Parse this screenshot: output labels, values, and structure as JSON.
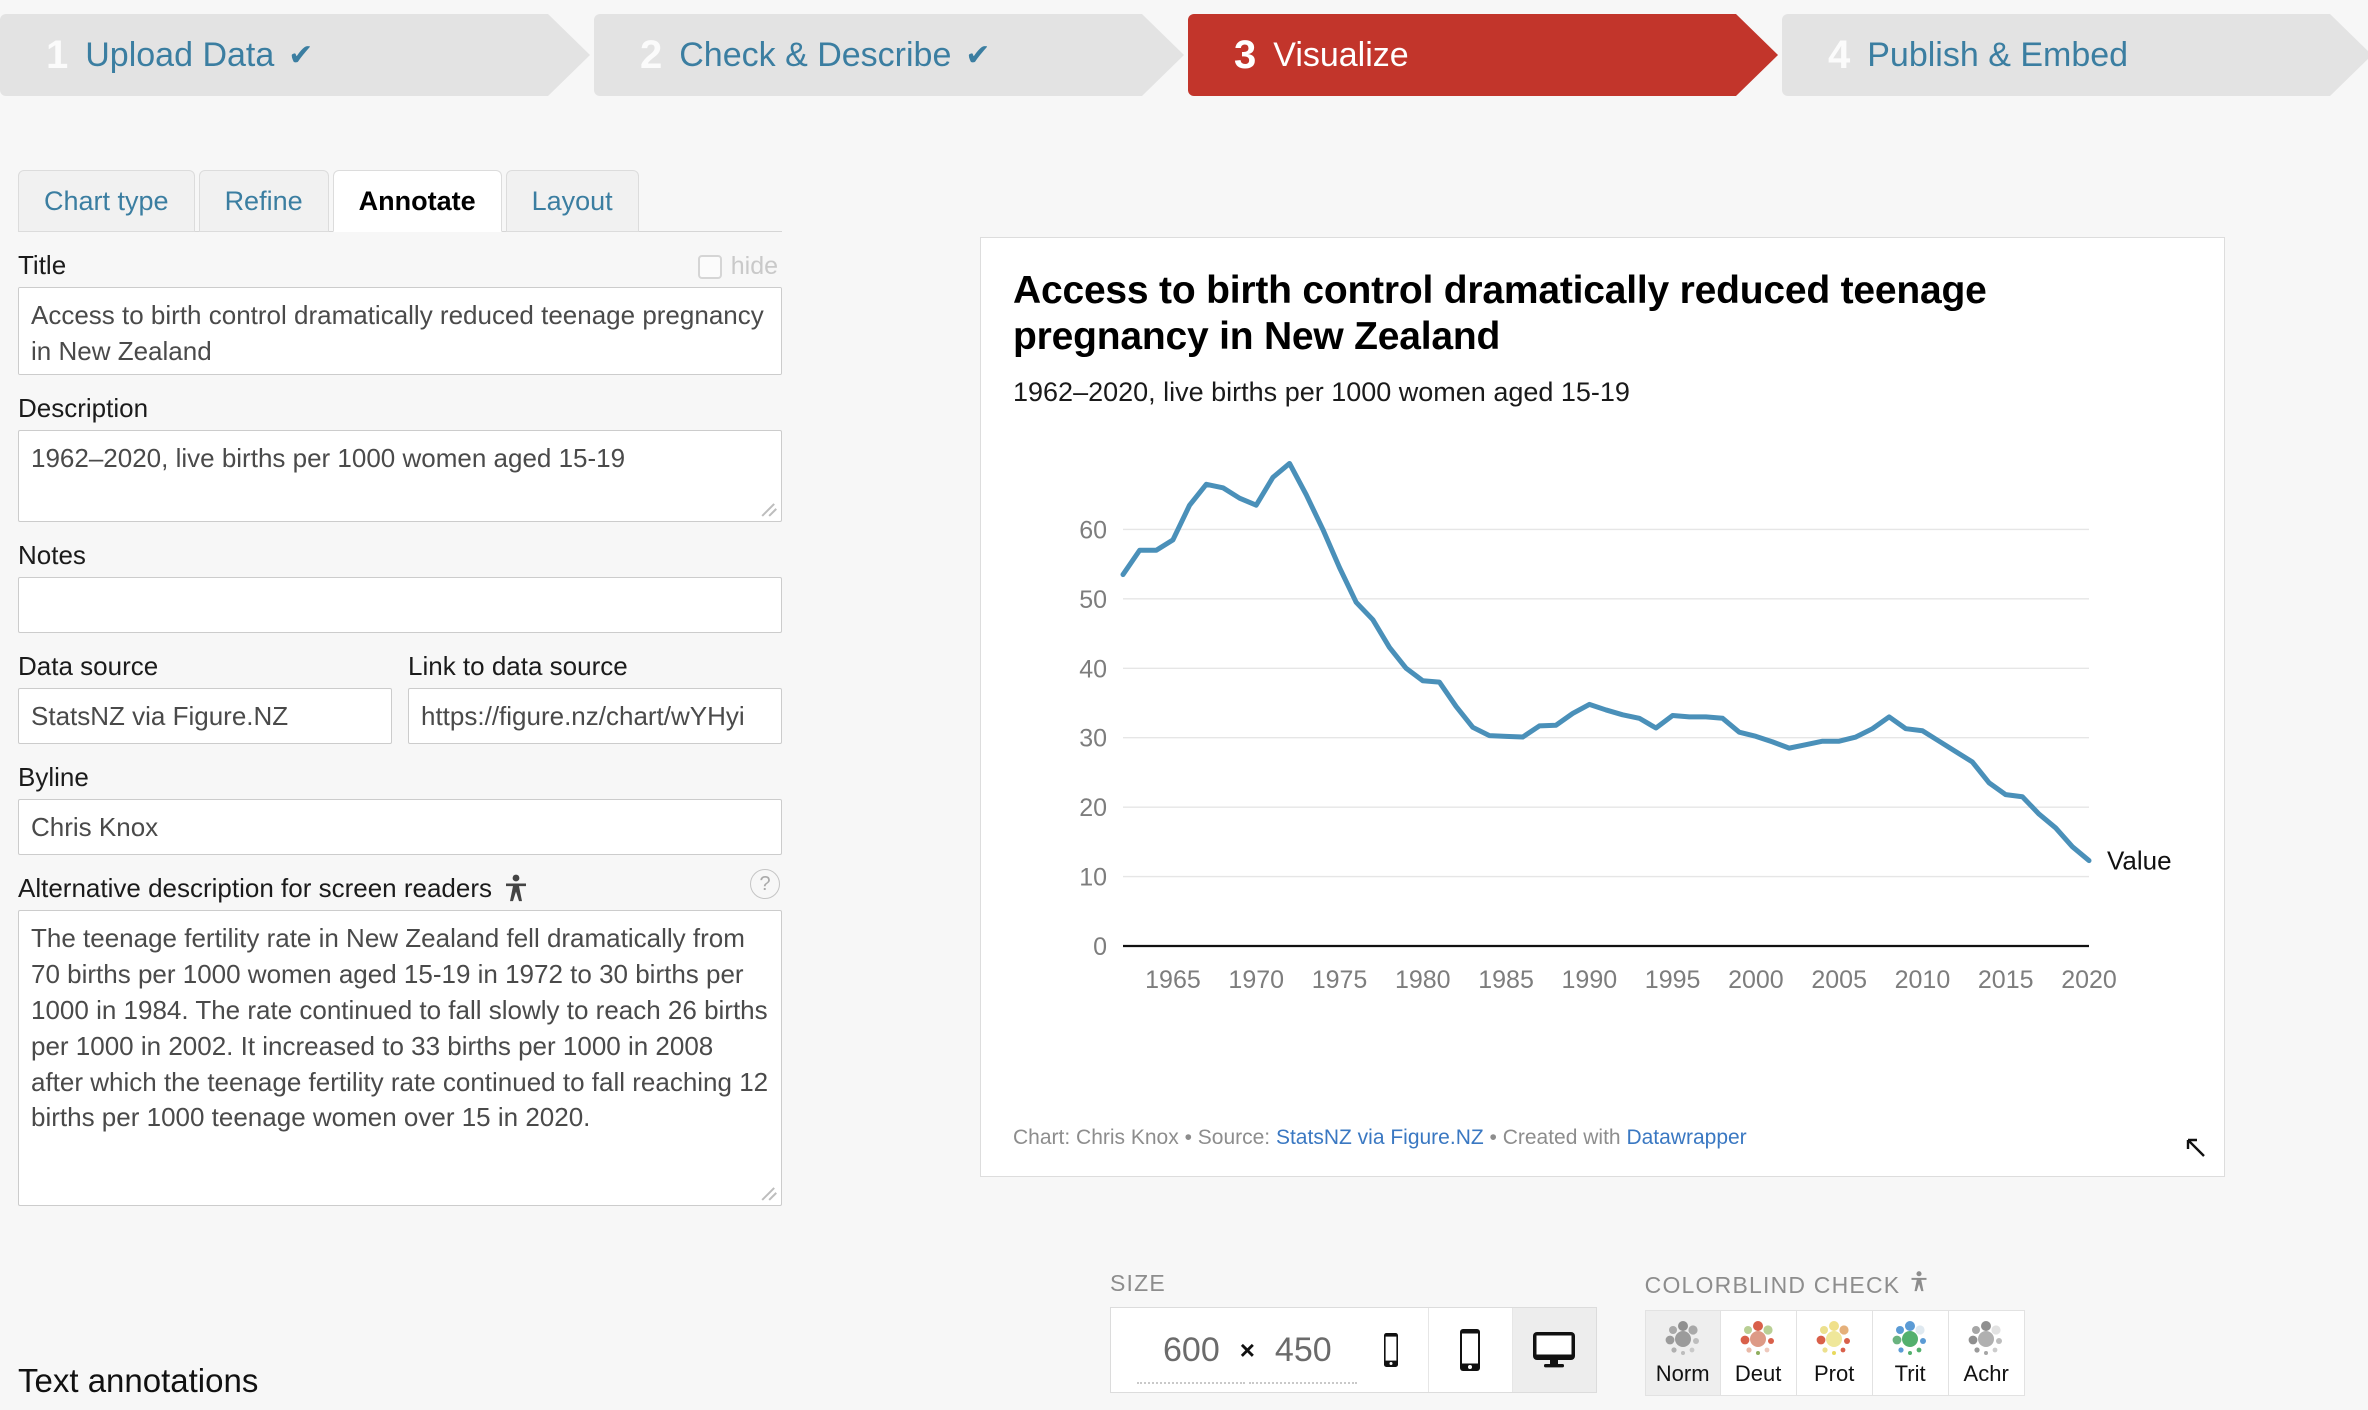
{
  "steps": [
    {
      "num": "1",
      "label": "Upload Data",
      "check": "✔",
      "state": "done"
    },
    {
      "num": "2",
      "label": "Check & Describe",
      "check": "✔",
      "state": "done"
    },
    {
      "num": "3",
      "label": "Visualize",
      "check": "",
      "state": "active"
    },
    {
      "num": "4",
      "label": "Publish & Embed",
      "check": "",
      "state": "todo"
    }
  ],
  "accent_active": "#c2352b",
  "accent_link": "#3b7ea1",
  "series_color": "#4a90b9",
  "tabs": [
    {
      "label": "Chart type",
      "active": false
    },
    {
      "label": "Refine",
      "active": false
    },
    {
      "label": "Annotate",
      "active": true
    },
    {
      "label": "Layout",
      "active": false
    }
  ],
  "form": {
    "title_label": "Title",
    "hide_label": "hide",
    "title_value": "Access to birth control dramatically reduced teenage pregnancy in New Zealand",
    "description_label": "Description",
    "description_value": "1962–2020, live births per 1000 women aged 15-19",
    "notes_label": "Notes",
    "notes_value": "",
    "data_source_label": "Data source",
    "data_source_value": "StatsNZ via Figure.NZ",
    "link_label": "Link to data source",
    "link_value": "https://figure.nz/chart/wYHyi",
    "byline_label": "Byline",
    "byline_value": "Chris Knox",
    "alt_label": "Alternative description for screen readers",
    "help_glyph": "?",
    "alt_value": "The teenage fertility rate in New Zealand fell dramatically from 70 births per 1000 women aged 15-19 in 1972 to 30 births per 1000 in 1984. The rate continued to fall slowly to reach 26 births per 1000 in 2002. It increased to 33 births per 1000 in 2008 after which the teenage fertility rate continued to fall reaching 12 births per 1000 teenage women over 15 in 2020.",
    "text_annotations_heading": "Text annotations"
  },
  "chart_card": {
    "footer_prefix": "Chart: ",
    "footer_author": "Chris Knox",
    "footer_sep1": " • Source: ",
    "footer_source": "StatsNZ via Figure.NZ",
    "footer_sep2": " • Created with ",
    "footer_tool": "Datawrapper"
  },
  "bottom": {
    "size_label": "SIZE",
    "width": "600",
    "x_glyph": "×",
    "height": "450",
    "colorblind_label": "COLORBLIND CHECK",
    "cb_buttons": [
      {
        "label": "Norm",
        "active": true
      },
      {
        "label": "Deut",
        "active": false
      },
      {
        "label": "Prot",
        "active": false
      },
      {
        "label": "Trit",
        "active": false
      },
      {
        "label": "Achr",
        "active": false
      }
    ]
  },
  "chart_data": {
    "type": "line",
    "title": "Access to birth control dramatically reduced teenage pregnancy in New Zealand",
    "subtitle": "1962–2020, live births per 1000 women aged 15-19",
    "xlabel": "",
    "ylabel": "",
    "series_name": "Value",
    "legend_position": "line-end-right",
    "grid": "horizontal",
    "xlim": [
      1962,
      2020
    ],
    "ylim": [
      0,
      70
    ],
    "yticks": [
      0,
      10,
      20,
      30,
      40,
      50,
      60
    ],
    "xticks": [
      1965,
      1970,
      1975,
      1980,
      1985,
      1990,
      1995,
      2000,
      2005,
      2010,
      2015,
      2020
    ],
    "x": [
      1962,
      1963,
      1964,
      1965,
      1966,
      1967,
      1968,
      1969,
      1970,
      1971,
      1972,
      1973,
      1974,
      1975,
      1976,
      1977,
      1978,
      1979,
      1980,
      1981,
      1982,
      1983,
      1984,
      1985,
      1986,
      1987,
      1988,
      1989,
      1990,
      1991,
      1992,
      1993,
      1994,
      1995,
      1996,
      1997,
      1998,
      1999,
      2000,
      2001,
      2002,
      2003,
      2004,
      2005,
      2006,
      2007,
      2008,
      2009,
      2010,
      2011,
      2012,
      2013,
      2014,
      2015,
      2016,
      2017,
      2018,
      2019,
      2020
    ],
    "values": [
      53.5,
      57.0,
      57.0,
      58.5,
      63.5,
      66.5,
      66.0,
      64.5,
      63.5,
      67.5,
      69.5,
      65.0,
      60.0,
      54.5,
      49.5,
      47.0,
      43.0,
      40.0,
      38.2,
      38.0,
      34.5,
      31.5,
      30.3,
      30.2,
      30.1,
      31.7,
      31.8,
      33.5,
      34.8,
      34.0,
      33.3,
      32.8,
      31.4,
      33.2,
      33.0,
      33.0,
      32.8,
      30.8,
      30.2,
      29.4,
      28.5,
      29.0,
      29.5,
      29.5,
      30.1,
      31.3,
      33.0,
      31.3,
      31.0,
      29.5,
      28.0,
      26.5,
      23.5,
      21.8,
      21.5,
      19.0,
      17.0,
      14.3,
      12.3
    ]
  }
}
